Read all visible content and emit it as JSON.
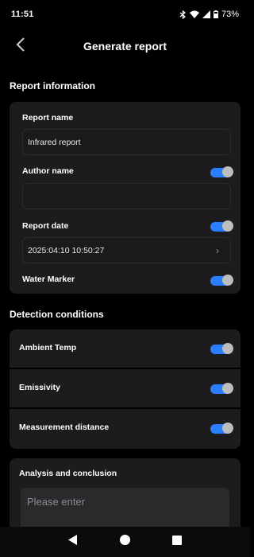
{
  "status_bar": {
    "time": "11:51",
    "battery": "73%"
  },
  "header": {
    "title": "Generate report"
  },
  "report_info": {
    "title": "Report information",
    "report_name_label": "Report name",
    "report_name_value": "Infrared report",
    "author_name_label": "Author name",
    "author_name_value": "",
    "report_date_label": "Report date",
    "report_date_value": "2025:04:10  10:50:27",
    "water_marker_label": "Water Marker"
  },
  "detection": {
    "title": "Detection conditions",
    "rows": [
      {
        "label": "Ambient Temp",
        "enabled": true
      },
      {
        "label": "Emissivity",
        "enabled": true
      },
      {
        "label": "Measurement distance",
        "enabled": true
      }
    ]
  },
  "analysis": {
    "title": "Analysis and conclusion",
    "placeholder": "Please enter"
  },
  "toggles": {
    "author_name": true,
    "report_date": true,
    "water_marker": true
  },
  "colors": {
    "accent": "#2a7fff",
    "card": "#1c1c1e",
    "background": "#000000"
  }
}
